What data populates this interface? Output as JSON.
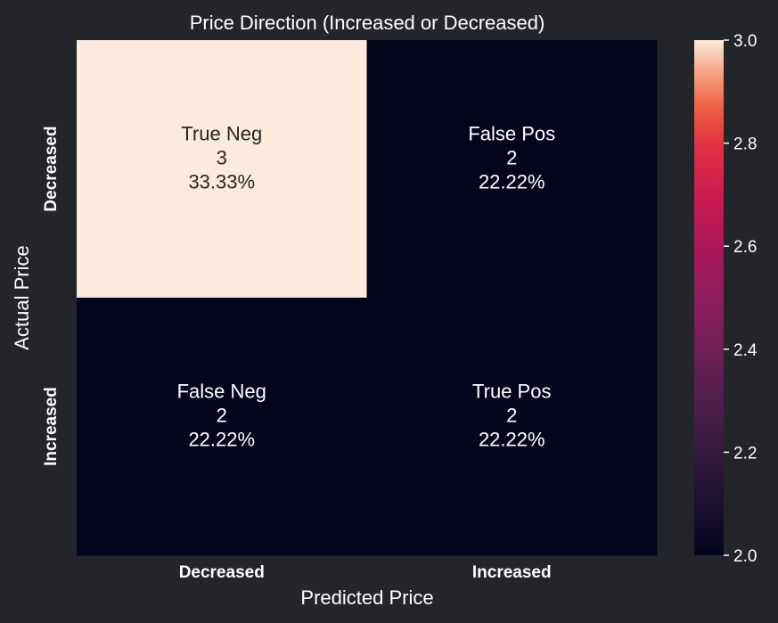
{
  "chart_data": {
    "type": "heatmap",
    "title": "Price Direction (Increased or Decreased)",
    "xlabel": "Predicted Price",
    "ylabel": "Actual Price",
    "x_categories": [
      "Decreased",
      "Increased"
    ],
    "y_categories": [
      "Decreased",
      "Increased"
    ],
    "values": [
      [
        3,
        2
      ],
      [
        2,
        2
      ]
    ],
    "cell_labels": [
      [
        [
          "True Neg",
          "3",
          "33.33%"
        ],
        [
          "False Pos",
          "2",
          "22.22%"
        ]
      ],
      [
        [
          "False Neg",
          "2",
          "22.22%"
        ],
        [
          "True Pos",
          "2",
          "22.22%"
        ]
      ]
    ],
    "colorbar": {
      "min": 2.0,
      "max": 3.0,
      "ticks": [
        "2.0",
        "2.2",
        "2.4",
        "2.6",
        "2.8",
        "3.0"
      ]
    },
    "colors": {
      "background": "#23252b",
      "low": "#03051a",
      "high": "#faebdd",
      "text_light": "#ffffff",
      "text_dark": "#262626"
    }
  }
}
